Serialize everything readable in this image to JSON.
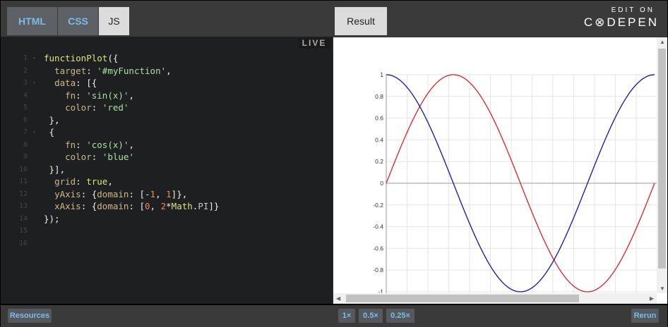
{
  "tabs": {
    "html": "HTML",
    "css": "CSS",
    "js": "JS",
    "result": "Result"
  },
  "brand": {
    "edit_on": "EDIT ON",
    "name": "C⊗DEPEN"
  },
  "editor": {
    "live_badge": "LIVE",
    "line_numbers": [
      "1",
      "2",
      "3",
      "4",
      "5",
      "6",
      "7",
      "8",
      "9",
      "10",
      "11",
      "12",
      "13",
      "14",
      "15",
      "16"
    ]
  },
  "bottom": {
    "resources": "Resources",
    "zoom_1x": "1×",
    "zoom_05x": "0.5×",
    "zoom_025x": "0.25×",
    "rerun": "Rerun"
  },
  "chart_data": {
    "type": "line",
    "x_range": [
      0,
      6.283185307
    ],
    "ylim": [
      -1,
      1
    ],
    "grid": true,
    "y_ticks": [
      "1",
      "0.8",
      "0.6",
      "0.4",
      "0.2",
      "0",
      "-0.2",
      "-0.4",
      "-0.6",
      "-0.8",
      "-1"
    ],
    "series": [
      {
        "fn": "sin(x)",
        "color": "#e02020"
      },
      {
        "fn": "cos(x)",
        "color": "#1010c0"
      }
    ]
  }
}
